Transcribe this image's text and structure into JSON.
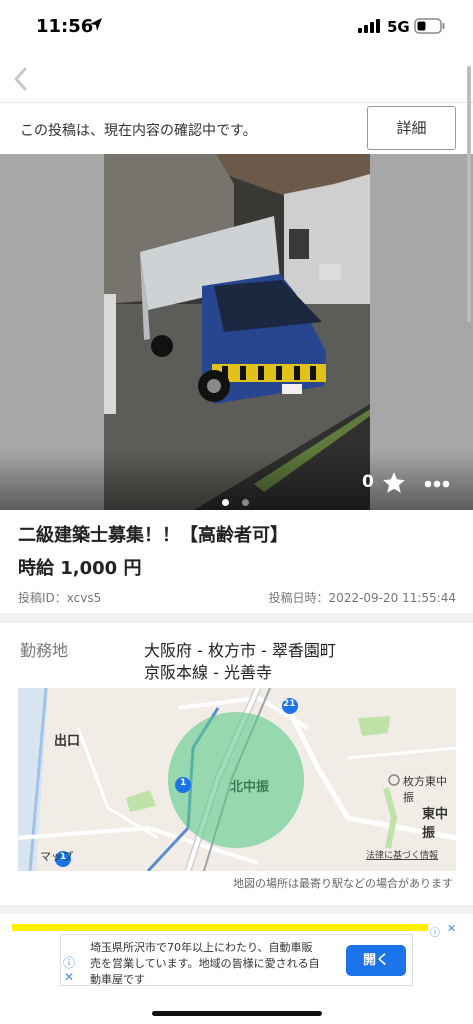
{
  "status": {
    "time": "11:56",
    "network": "5G"
  },
  "notice": {
    "text": "この投稿は、現在内容の確認中です。",
    "detail_label": "詳細"
  },
  "gallery": {
    "favorite_count": "0",
    "photo_count": 2,
    "current_photo": 1
  },
  "job": {
    "title": "二級建築士募集！！【高齢者可】",
    "wage": "時給 1,000 円",
    "post_id": "投稿ID：xcvs5",
    "post_date": "投稿日時：2022-09-20 11:55:44"
  },
  "location": {
    "label": "勤務地",
    "line1": "大阪府 - 枚方市 - 翠香園町",
    "line2": "京阪本線 - 光善寺",
    "map_labels": {
      "deguchi": "出口",
      "kitanakaburi": "北中振",
      "hirakata": "枚方東中振",
      "higashinaka": "東中振",
      "legal": "法律に基づく情報",
      "brand": "マップ",
      "route21": "21",
      "route1": "1",
      "route1b": "1"
    },
    "map_note": "地図の場所は最寄り駅などの場合があります"
  },
  "ad": {
    "text": "埼玉県所沢市で70年以上にわたり、自動車販売を営業しています。地域の皆様に愛される自動車屋です",
    "open_label": "開く"
  },
  "colors": {
    "accent": "#1a73e8",
    "ad_yellow": "#fff000",
    "map_circle": "#5cc98a"
  }
}
